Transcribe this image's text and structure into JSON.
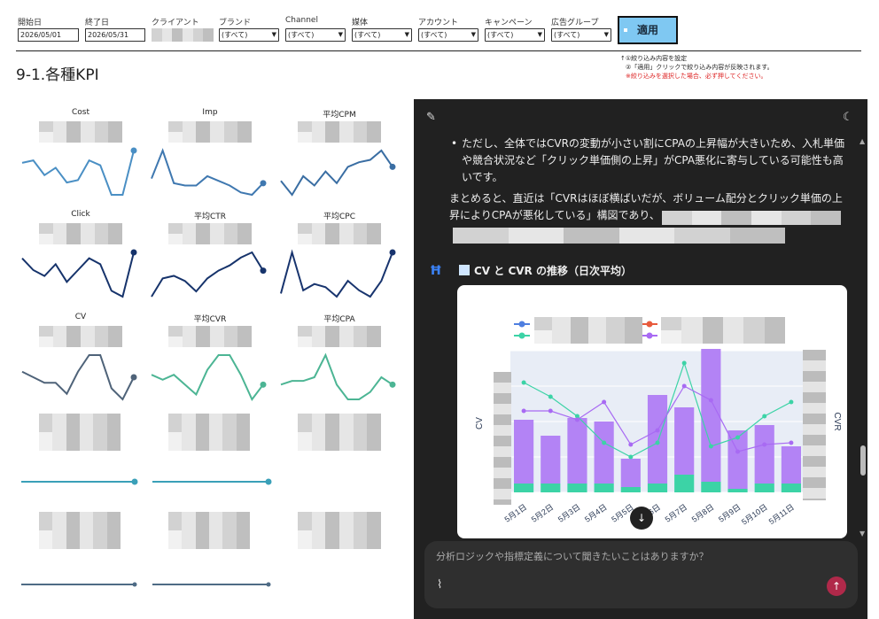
{
  "filters": {
    "start_date": {
      "label": "開始日",
      "value": "2026/05/01"
    },
    "end_date": {
      "label": "終了日",
      "value": "2026/05/31"
    },
    "client": {
      "label": "クライアント"
    },
    "brand": {
      "label": "ブランド",
      "value": "(すべて)"
    },
    "channel": {
      "label": "Channel",
      "value": "(すべて)"
    },
    "media": {
      "label": "媒体",
      "value": "(すべて)"
    },
    "account": {
      "label": "アカウント",
      "value": "(すべて)"
    },
    "campaign": {
      "label": "キャンペーン",
      "value": "(すべて)"
    },
    "adgroup": {
      "label": "広告グループ",
      "value": "(すべて)"
    },
    "apply_label": "適用"
  },
  "note": {
    "line1": "↑①絞り込み内容を設定",
    "line2": "②「適用」クリックで絞り込み内容が反映されます。",
    "line3": "※絞り込みを選択した場合、必ず押してください。"
  },
  "page_title": "9-1.各種KPI",
  "kpis": [
    {
      "title": "Cost",
      "color": "#4a8fc4",
      "values": [
        6.5,
        7,
        4,
        5.5,
        2.5,
        3,
        7,
        6,
        0,
        0,
        9
      ]
    },
    {
      "title": "Imp",
      "color": "#3f78b0",
      "values": [
        4,
        10,
        3,
        2.5,
        2.5,
        4.5,
        3.5,
        2.5,
        1,
        0.5,
        3
      ]
    },
    {
      "title": "平均CPM",
      "color": "#3a6ea3",
      "values": [
        3,
        0,
        4,
        2,
        5,
        2.5,
        6,
        7,
        7.5,
        9.5,
        6
      ]
    },
    {
      "title": "Click",
      "color": "#16336b",
      "values": [
        7,
        5,
        4,
        6,
        3,
        5,
        7,
        6,
        1.5,
        0.5,
        8
      ]
    },
    {
      "title": "平均CTR",
      "color": "#16336b",
      "values": [
        1,
        4.5,
        5,
        4,
        2,
        4.5,
        6,
        7,
        8.5,
        9.5,
        6
      ]
    },
    {
      "title": "平均CPC",
      "color": "#18346e",
      "values": [
        1.5,
        8,
        2,
        3,
        2.5,
        1,
        3.5,
        2,
        1,
        3.5,
        8
      ]
    },
    {
      "title": "CV",
      "color": "#4f6379",
      "values": [
        6,
        5,
        4,
        4,
        2,
        6,
        9,
        9,
        3,
        1,
        5
      ]
    },
    {
      "title": "平均CVR",
      "color": "#4cb594",
      "values": [
        6,
        5,
        6,
        4,
        2,
        7,
        10,
        10,
        6,
        1,
        4
      ]
    },
    {
      "title": "平均CPA",
      "color": "#4cb594",
      "values": [
        5,
        5.5,
        5.5,
        6,
        9,
        5,
        3,
        3,
        4,
        6,
        5
      ]
    }
  ],
  "chat": {
    "bullet_text": "ただし、全体ではCVRの変動が小さい割にCPAの上昇幅が大きいため、入札単価や競合状況など「クリック単価側の上昇」がCPA悪化に寄与している可能性も高いです。",
    "summary_part1": "まとめると、直近は「CVRはほぼ横ばいだが、ボリューム配分とクリック単価の上",
    "summary_part2": "昇によりCPAが悪化している」構図であり、",
    "chart_heading": "CV と CVR の推移（日次平均）",
    "chart_heading_icon": "chart-emoji-icon",
    "input_placeholder": "分析ロジックや指標定義について聞きたいことはありますか？"
  },
  "chart_data": {
    "type": "bar",
    "categories": [
      "5月1日",
      "5月2日",
      "5月3日",
      "5月4日",
      "5月5日",
      "5月6日",
      "5月7日",
      "5月8日",
      "5月9日",
      "5月10日",
      "5月11日"
    ],
    "series": [
      {
        "kind": "bar",
        "color": "#b383f5",
        "values": [
          36,
          27,
          37,
          35,
          16,
          50,
          38,
          75,
          33,
          33,
          21
        ]
      },
      {
        "kind": "bar",
        "color": "#3cd3a6",
        "values": [
          5,
          5,
          5,
          5,
          3,
          5,
          10,
          6,
          2,
          5,
          5
        ]
      },
      {
        "kind": "line",
        "color": "#3cd3a6",
        "values": [
          62,
          54,
          43,
          28,
          20,
          28,
          73,
          26,
          31,
          43,
          51
        ]
      },
      {
        "kind": "line",
        "color": "#a86af3",
        "values": [
          46,
          46,
          41,
          51,
          27,
          35,
          60,
          52,
          23,
          27,
          28
        ]
      }
    ],
    "ylabel_left": "CV",
    "ylabel_right": "CVR",
    "ylim": [
      0,
      80
    ]
  }
}
